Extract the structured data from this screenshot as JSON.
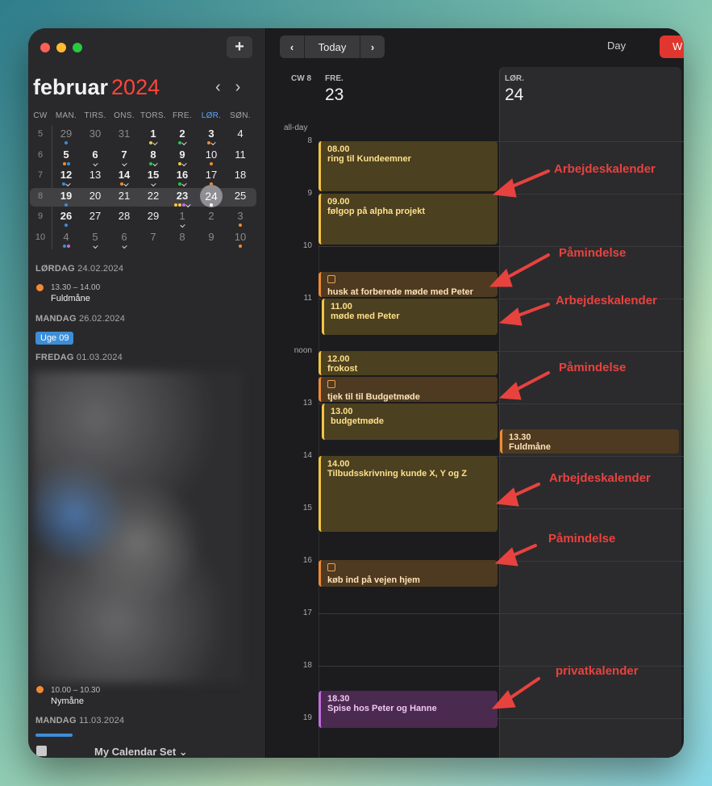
{
  "sidebar": {
    "add_label": "+",
    "month": "februar",
    "year": "2024",
    "prev": "‹",
    "next": "›",
    "headers": [
      "CW",
      "MAN.",
      "TIRS.",
      "ONS.",
      "TORS.",
      "FRE.",
      "LØR.",
      "SØN."
    ],
    "rows": [
      {
        "cw": "5",
        "days": [
          "29",
          "30",
          "31",
          "1",
          "2",
          "3",
          "4"
        ]
      },
      {
        "cw": "6",
        "days": [
          "5",
          "6",
          "7",
          "8",
          "9",
          "10",
          "11"
        ]
      },
      {
        "cw": "7",
        "days": [
          "12",
          "13",
          "14",
          "15",
          "16",
          "17",
          "18"
        ]
      },
      {
        "cw": "8",
        "days": [
          "19",
          "20",
          "21",
          "22",
          "23",
          "24",
          "25"
        ]
      },
      {
        "cw": "9",
        "days": [
          "26",
          "27",
          "28",
          "29",
          "1",
          "2",
          "3"
        ]
      },
      {
        "cw": "10",
        "days": [
          "4",
          "5",
          "6",
          "7",
          "8",
          "9",
          "10"
        ]
      }
    ],
    "sections": [
      {
        "head": "LØRDAG",
        "date": "24.02.2024"
      },
      {
        "head": "MANDAG",
        "date": "26.02.2024"
      },
      {
        "head": "FREDAG",
        "date": "01.03.2024"
      },
      {
        "head": "MANDAG",
        "date": "11.03.2024"
      }
    ],
    "ev1_time": "13.30 – 14.00",
    "ev1_title": "Fuldmåne",
    "week_badge": "Uge 09",
    "ev2_time": "10.00 – 10.30",
    "ev2_title": "Nymåne",
    "calendar_set": "My Calendar Set ⌄"
  },
  "toolbar": {
    "prev": "‹",
    "today": "Today",
    "next": "›",
    "day": "Day",
    "week": "W"
  },
  "grid": {
    "cw": "CW 8",
    "days": [
      {
        "name": "FRE.",
        "num": "23"
      },
      {
        "name": "LØR.",
        "num": "24"
      }
    ],
    "allday": "all-day",
    "hours": [
      "8",
      "9",
      "10",
      "11",
      "noon",
      "13",
      "14",
      "15",
      "16",
      "17",
      "18",
      "19"
    ]
  },
  "events": [
    {
      "time": "08.00",
      "title": "ring til Kundeemner"
    },
    {
      "time": "09.00",
      "title": "følgop på alpha projekt"
    },
    {
      "title": "husk at forberede møde med Peter"
    },
    {
      "time": "11.00",
      "title": "møde med Peter"
    },
    {
      "time": "12.00",
      "title": "frokost"
    },
    {
      "title": "tjek til til Budgetmøde"
    },
    {
      "time": "13.00",
      "title": "budgetmøde"
    },
    {
      "time": "14.00",
      "title": "Tilbudsskrivning kunde X, Y og Z"
    },
    {
      "title": "køb ind på vejen hjem"
    },
    {
      "time": "18.30",
      "title": "Spise hos Peter og Hanne"
    },
    {
      "time": "13.30",
      "title": "Fuldmåne"
    }
  ],
  "annotations": [
    "Arbejdeskalender",
    "Påmindelse",
    "Arbejdeskalender",
    "Påmindelse",
    "Arbejdeskalender",
    "Påmindelse",
    "privatkalender"
  ],
  "colors": {
    "accent": "#e0362f",
    "work": "#f5c542",
    "reminder": "#f08a34",
    "private": "#c46be0",
    "annotation": "#e8423f"
  }
}
